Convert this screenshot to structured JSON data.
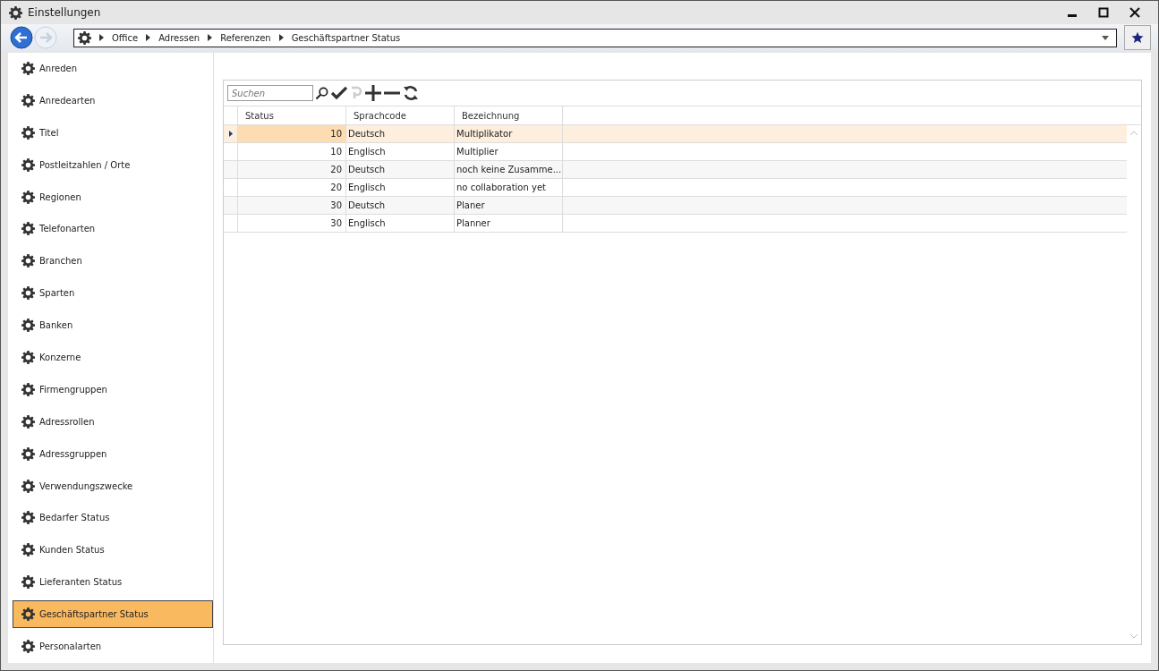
{
  "window": {
    "title": "Einstellungen"
  },
  "breadcrumb": [
    "Office",
    "Adressen",
    "Referenzen",
    "Geschäftspartner Status"
  ],
  "sidebar": {
    "items": [
      {
        "label": "Anreden",
        "selected": false
      },
      {
        "label": "Anredearten",
        "selected": false
      },
      {
        "label": "Titel",
        "selected": false
      },
      {
        "label": "Postleitzahlen / Orte",
        "selected": false
      },
      {
        "label": "Regionen",
        "selected": false
      },
      {
        "label": "Telefonarten",
        "selected": false
      },
      {
        "label": "Branchen",
        "selected": false
      },
      {
        "label": "Sparten",
        "selected": false
      },
      {
        "label": "Banken",
        "selected": false
      },
      {
        "label": "Konzerne",
        "selected": false
      },
      {
        "label": "Firmengruppen",
        "selected": false
      },
      {
        "label": "Adressrollen",
        "selected": false
      },
      {
        "label": "Adressgruppen",
        "selected": false
      },
      {
        "label": "Verwendungszwecke",
        "selected": false
      },
      {
        "label": "Bedarfer Status",
        "selected": false
      },
      {
        "label": "Kunden Status",
        "selected": false
      },
      {
        "label": "Lieferanten Status",
        "selected": false
      },
      {
        "label": "Geschäftspartner Status",
        "selected": true
      },
      {
        "label": "Personalarten",
        "selected": false
      }
    ]
  },
  "search": {
    "placeholder": "Suchen"
  },
  "toolbar": {
    "undo_disabled": true
  },
  "table": {
    "columns": [
      "Status",
      "Sprachcode",
      "Bezeichnung"
    ],
    "rows": [
      {
        "cells": [
          "10",
          "Deutsch",
          "Multiplikator"
        ],
        "selected": true
      },
      {
        "cells": [
          "10",
          "Englisch",
          "Multiplier"
        ],
        "selected": false
      },
      {
        "cells": [
          "20",
          "Deutsch",
          "noch keine Zusamme..."
        ],
        "selected": false
      },
      {
        "cells": [
          "20",
          "Englisch",
          "no collaboration yet"
        ],
        "selected": false
      },
      {
        "cells": [
          "30",
          "Deutsch",
          "Planer"
        ],
        "selected": false
      },
      {
        "cells": [
          "30",
          "Englisch",
          "Planner"
        ],
        "selected": false
      }
    ]
  }
}
